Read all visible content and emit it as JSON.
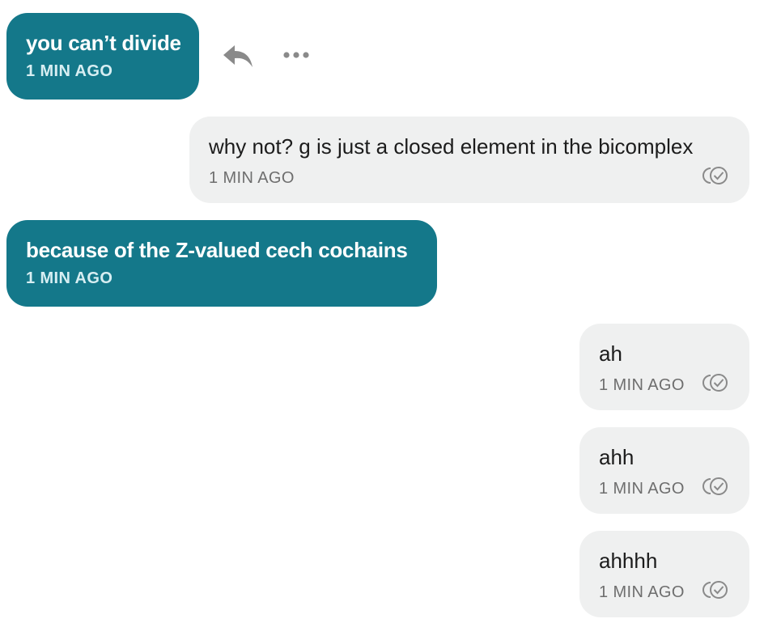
{
  "messages": [
    {
      "direction": "incoming",
      "text": "you can’t divide",
      "time": "1 MIN AGO"
    },
    {
      "direction": "outgoing",
      "text": "why not? g is just a closed element in the bicomplex",
      "time": "1 MIN AGO",
      "status_icon": "read-receipt-icon"
    },
    {
      "direction": "incoming",
      "text": "because of the Z-valued cech cochains",
      "time": "1 MIN AGO"
    },
    {
      "direction": "outgoing",
      "text": "ah",
      "time": "1 MIN AGO",
      "status_icon": "read-receipt-icon"
    },
    {
      "direction": "outgoing",
      "text": "ahh",
      "time": "1 MIN AGO",
      "status_icon": "read-receipt-icon"
    },
    {
      "direction": "outgoing",
      "text": "ahhhh",
      "time": "1 MIN AGO",
      "status_icon": "read-receipt-icon"
    }
  ],
  "message_actions": {
    "reply_icon": "reply-icon",
    "more_icon": "more-options-icon"
  },
  "colors": {
    "incoming_bubble": "#14788a",
    "outgoing_bubble": "#eff0f0",
    "icon_gray": "#8a8a8a"
  }
}
